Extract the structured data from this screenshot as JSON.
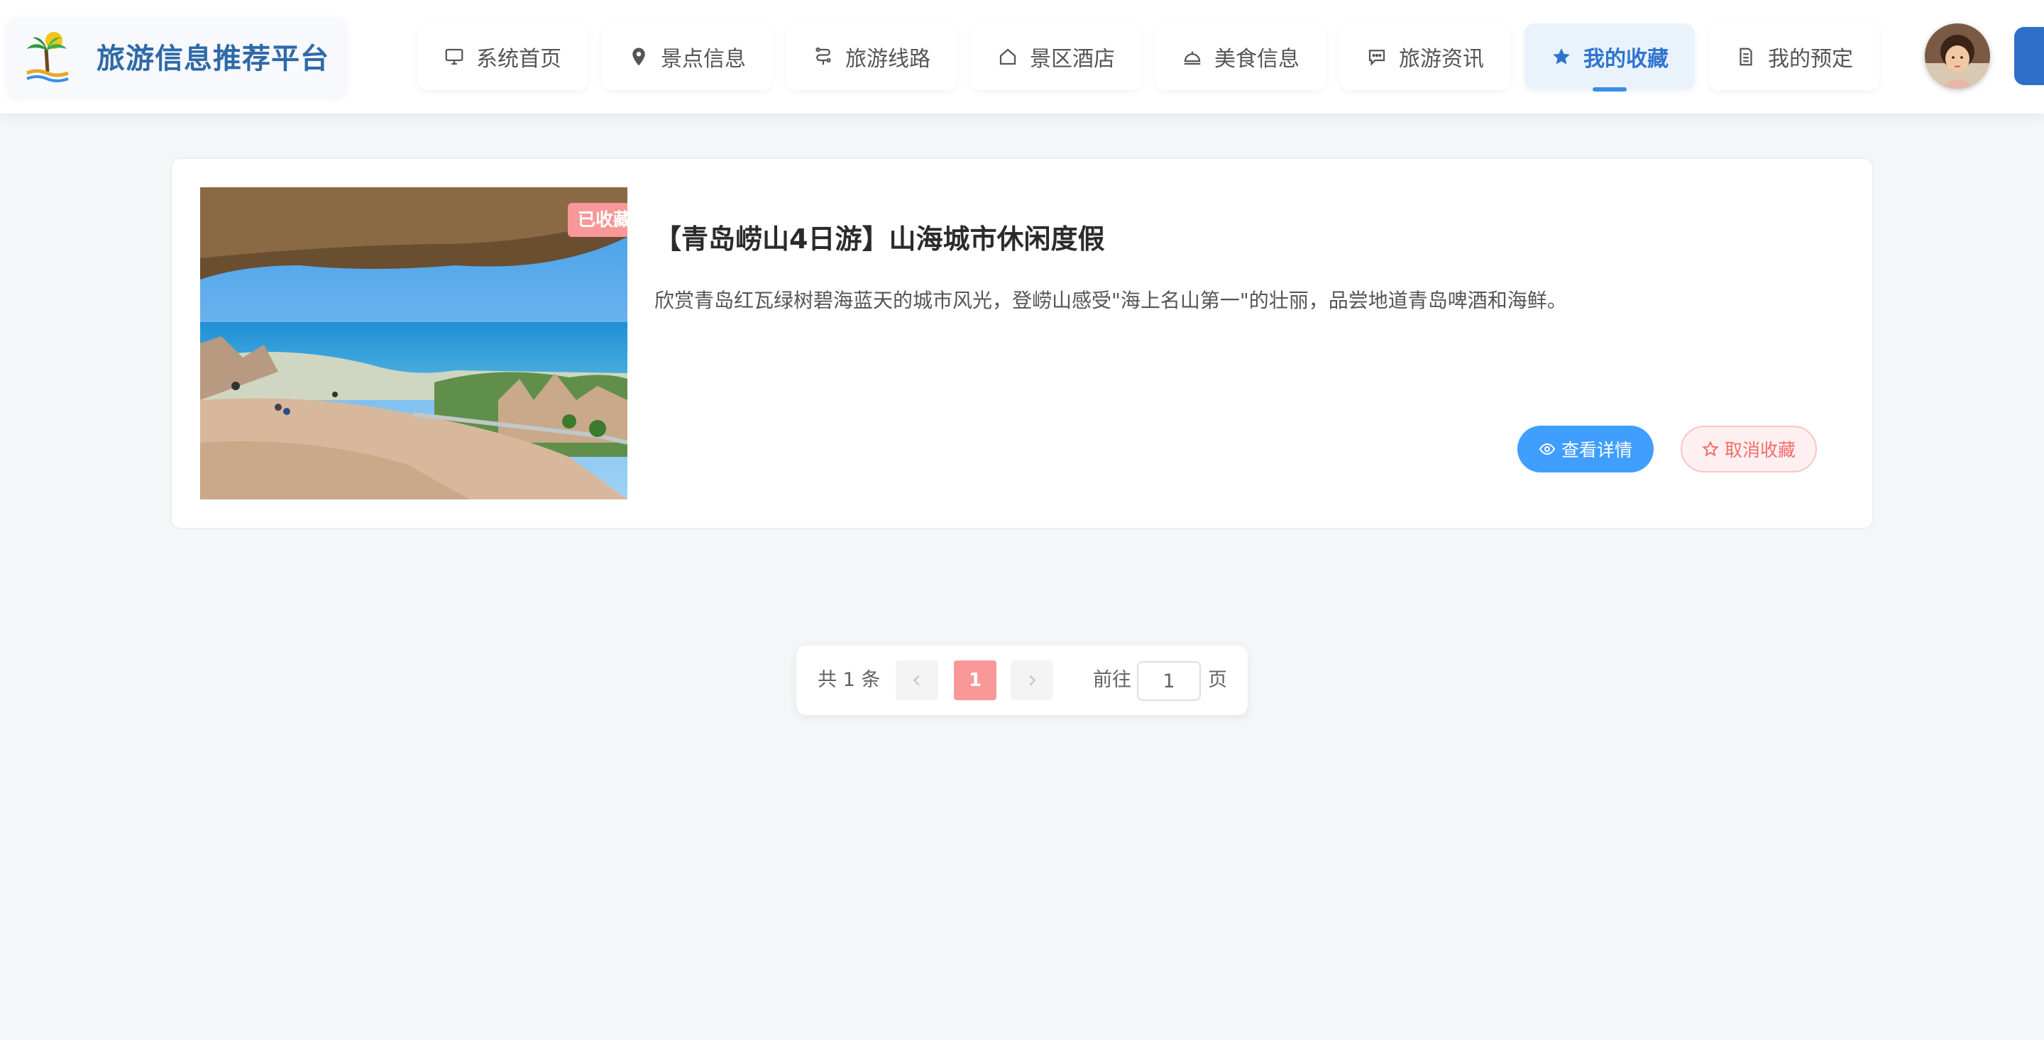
{
  "brand": {
    "title": "旅游信息推荐平台"
  },
  "nav": {
    "items": [
      {
        "label": "系统首页",
        "icon": "monitor-icon"
      },
      {
        "label": "景点信息",
        "icon": "location-pin-icon"
      },
      {
        "label": "旅游线路",
        "icon": "route-icon"
      },
      {
        "label": "景区酒店",
        "icon": "house-icon"
      },
      {
        "label": "美食信息",
        "icon": "food-cloche-icon"
      },
      {
        "label": "旅游资讯",
        "icon": "chat-bubble-icon"
      },
      {
        "label": "我的收藏",
        "icon": "star-icon",
        "active": true
      },
      {
        "label": "我的预定",
        "icon": "document-icon"
      }
    ]
  },
  "favorite": {
    "badge": "已收藏",
    "title": "【青岛崂山4日游】山海城市休闲度假",
    "description": "欣赏青岛红瓦绿树碧海蓝天的城市风光，登崂山感受\"海上名山第一\"的壮丽，品尝地道青岛啤酒和海鲜。",
    "view_button": "查看详情",
    "unfavorite_button": "取消收藏"
  },
  "pagination": {
    "total_text": "共 1 条",
    "current_page": "1",
    "goto_label": "前往",
    "goto_value": "1",
    "page_suffix": "页"
  },
  "colors": {
    "accent_blue": "#409eff",
    "brand_blue": "#2f6aa8",
    "badge_pink": "#f89898",
    "danger": "#f56c6c"
  }
}
